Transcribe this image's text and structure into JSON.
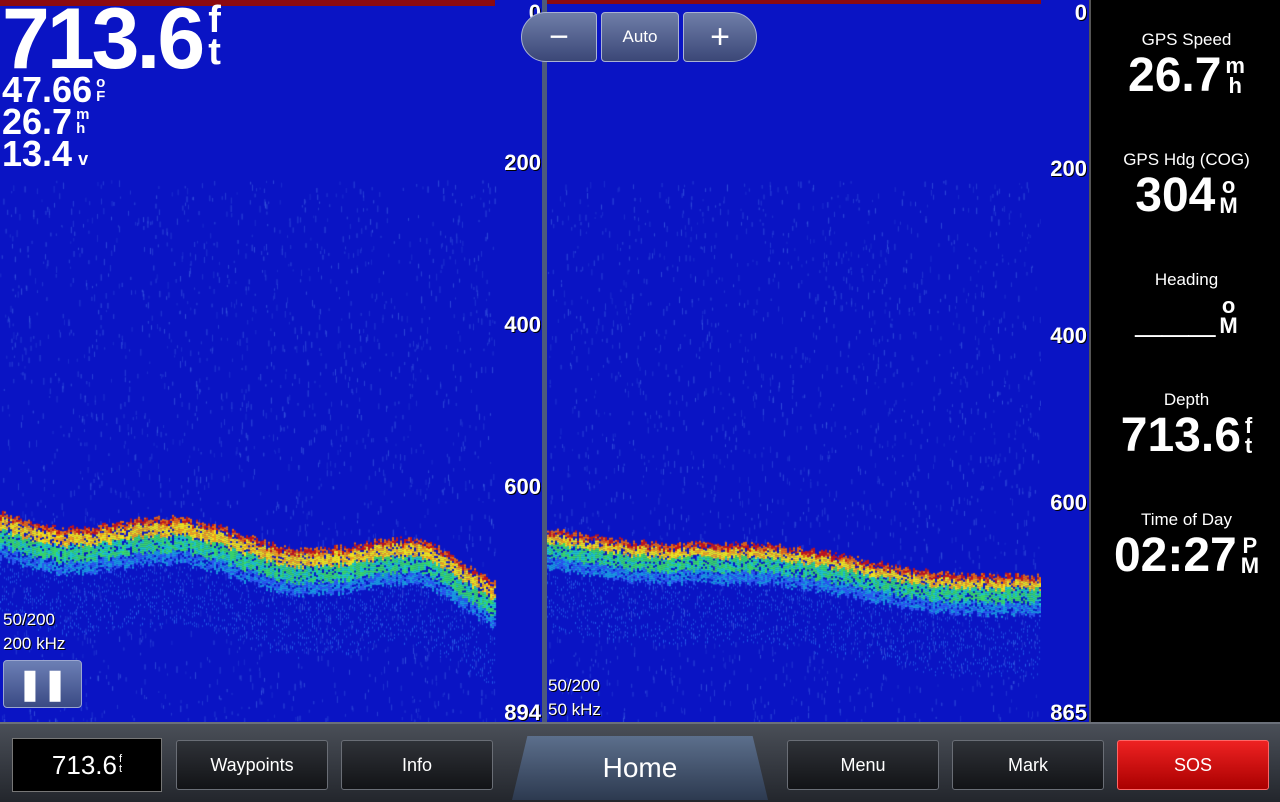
{
  "overlay": {
    "depth_value": "713.6",
    "depth_unit": [
      "f",
      "t"
    ],
    "water_temp_value": "47.66",
    "water_temp_unit": [
      "o",
      "F"
    ],
    "speed_value": "26.7",
    "speed_unit": [
      "m",
      "h"
    ],
    "voltage_value": "13.4",
    "voltage_unit": "v"
  },
  "left_panel": {
    "range_label": "50/200",
    "frequency_label": "200 kHz",
    "pause_icon": "pause-icon",
    "scale": [
      "0",
      "200",
      "400",
      "600",
      "894"
    ]
  },
  "right_panel": {
    "range_label": "50/200",
    "frequency_label": "50 kHz",
    "scale": [
      "0",
      "200",
      "400",
      "600",
      "865"
    ]
  },
  "zoom": {
    "minus_label": "−",
    "auto_label": "Auto",
    "plus_label": "+"
  },
  "sidebar": {
    "fields": [
      {
        "label": "GPS Speed",
        "value": "26.7",
        "unit": [
          "m",
          "h"
        ]
      },
      {
        "label": "GPS Hdg (COG)",
        "value": "304",
        "unit": [
          "o",
          "M"
        ]
      },
      {
        "label": "Heading",
        "value": "___",
        "unit": [
          "o",
          "M"
        ]
      },
      {
        "label": "Depth",
        "value": "713.6",
        "unit": [
          "f",
          "t"
        ]
      },
      {
        "label": "Time of Day",
        "value": "02:27",
        "unit": [
          "P",
          "M"
        ]
      }
    ]
  },
  "bottom_bar": {
    "depth_value": "713.6",
    "depth_unit": [
      "f",
      "t"
    ],
    "waypoints_label": "Waypoints",
    "info_label": "Info",
    "home_label": "Home",
    "menu_label": "Menu",
    "mark_label": "Mark",
    "sos_label": "SOS"
  },
  "colors": {
    "water": "#0a14c4",
    "bottom_return_strong": "#c81414",
    "bottom_return_mid": "#f0e61e",
    "bottom_return_weak": "#1ec8c8",
    "sos": "#dd2222"
  }
}
